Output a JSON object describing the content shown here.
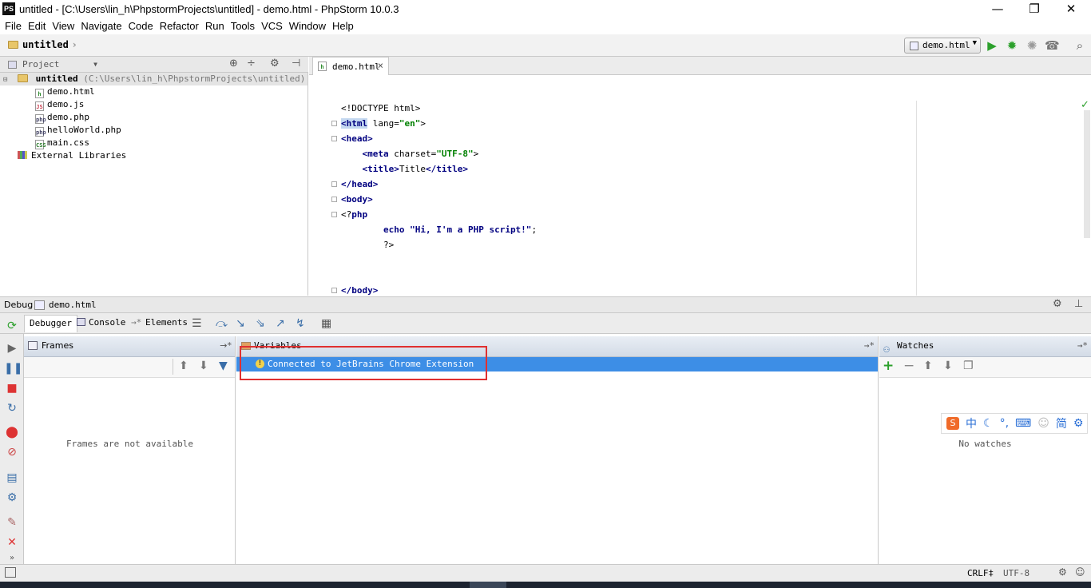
{
  "window": {
    "title": "untitled - [C:\\Users\\lin_h\\PhpstormProjects\\untitled] - demo.html - PhpStorm 10.0.3",
    "logo": "PS",
    "controls": {
      "minimize": "—",
      "restore": "❐",
      "close": "✕"
    }
  },
  "menu": [
    "File",
    "Edit",
    "View",
    "Navigate",
    "Code",
    "Refactor",
    "Run",
    "Tools",
    "VCS",
    "Window",
    "Help"
  ],
  "breadcrumb": "untitled",
  "run_config": "demo.html",
  "project_panel": {
    "selector_label": "Project",
    "root_name": "untitled",
    "root_path": "(C:\\Users\\lin_h\\PhpstormProjects\\untitled)",
    "files": [
      {
        "name": "demo.html",
        "icon": "html-file-icon",
        "badge": "h"
      },
      {
        "name": "demo.js",
        "icon": "js-file-icon",
        "badge": "JS"
      },
      {
        "name": "demo.php",
        "icon": "php-file-icon",
        "badge": "php"
      },
      {
        "name": "helloWorld.php",
        "icon": "php-file-icon",
        "badge": "php"
      },
      {
        "name": "main.css",
        "icon": "css-file-icon",
        "badge": "CSS"
      }
    ],
    "external": "External Libraries"
  },
  "editor": {
    "tab": "demo.html",
    "tab_close": "×",
    "lines": [
      "<!DOCTYPE html>",
      "<html lang=\"en\">",
      "<head>",
      "    <meta charset=\"UTF-8\">",
      "    <title>Title</title>",
      "</head>",
      "<body>",
      "<?php",
      "        echo \"Hi, I'm a PHP script!\";",
      "        ?>",
      "",
      "",
      "</body>"
    ]
  },
  "debug": {
    "label": "Debug",
    "config": "demo.html",
    "tabs": [
      "Debugger",
      "Console",
      "Elements"
    ],
    "tab_suffix": "→*",
    "frames": {
      "title": "Frames",
      "empty": "Frames are not available"
    },
    "variables": {
      "title": "Variables",
      "message": "Connected to JetBrains Chrome Extension"
    },
    "watches": {
      "title": "Watches",
      "empty": "No watches"
    }
  },
  "status": {
    "line_sep": "CRLF‡",
    "encoding": "UTF-8"
  },
  "ime": {
    "chars": [
      "中",
      "简"
    ]
  },
  "colors": {
    "selection": "#3d8ee6",
    "highlight_box": "#e03030",
    "run_green": "#2ca02c"
  }
}
